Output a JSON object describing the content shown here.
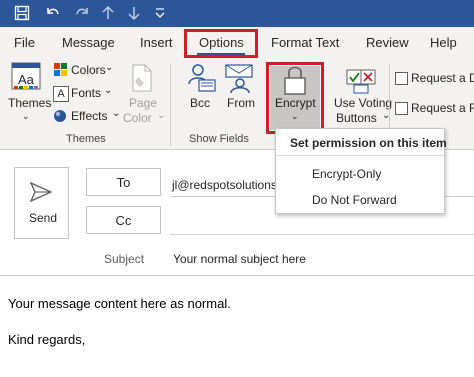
{
  "colors": {
    "titlebar": "#2b579a",
    "highlight": "#cc1f2a",
    "ribbon_bg": "#f3f2f1"
  },
  "tabs": [
    {
      "label": "File"
    },
    {
      "label": "Message"
    },
    {
      "label": "Insert"
    },
    {
      "label": "Options"
    },
    {
      "label": "Format Text"
    },
    {
      "label": "Review"
    },
    {
      "label": "Help"
    }
  ],
  "ribbon": {
    "themes_label": "Themes",
    "colors_label": "Colors",
    "fonts_label": "Fonts",
    "effects_label": "Effects",
    "page_color_line1": "Page",
    "page_color_line2": "Color",
    "group_themes": "Themes",
    "bcc_label": "Bcc",
    "from_label": "From",
    "group_show_fields": "Show Fields",
    "encrypt_label": "Encrypt",
    "voting_line1": "Use Voting",
    "voting_line2": "Buttons",
    "request_delivery": "Request a De",
    "request_read": "Request a Re"
  },
  "menu": {
    "title": "Set permission on this item",
    "items": [
      "Encrypt-Only",
      "Do Not Forward"
    ]
  },
  "compose": {
    "send_label": "Send",
    "to_label": "To",
    "cc_label": "Cc",
    "to_value": "jl@redspotsolutions.",
    "subject_label": "Subject",
    "subject_value": "Your normal subject here",
    "body_line1": "Your message content here as normal.",
    "body_line2": "Kind regards,"
  }
}
